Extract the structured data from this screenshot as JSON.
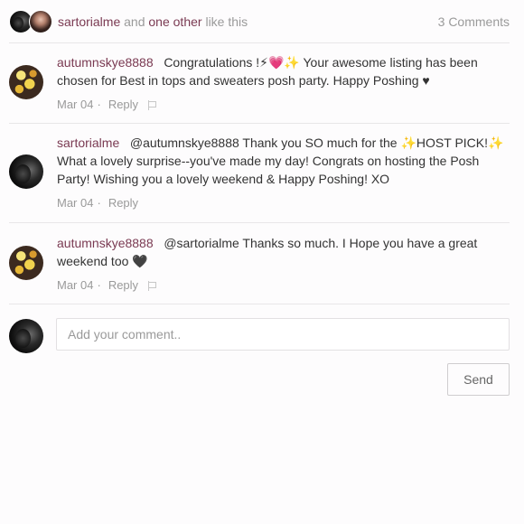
{
  "likes": {
    "user": "sartorialme",
    "connector": "and",
    "others": "one other",
    "suffix": "like this",
    "comments_count": "3 Comments"
  },
  "comments": [
    {
      "author": "autumnskye8888",
      "text": "Congratulations !⚡💗✨ Your awesome listing has been chosen for Best in tops and sweaters posh party. Happy Poshing ♥",
      "date": "Mar 04",
      "reply": "Reply"
    },
    {
      "author": "sartorialme",
      "text": "@autumnskye8888 Thank you SO much for the ✨HOST PICK!✨ What a lovely surprise--you've made my day! Congrats on hosting the Posh Party! Wishing you a lovely weekend & Happy Poshing! XO",
      "date": "Mar 04",
      "reply": "Reply"
    },
    {
      "author": "autumnskye8888",
      "text": "@sartorialme Thanks so much. I Hope you have a great weekend too 🖤",
      "date": "Mar 04",
      "reply": "Reply"
    }
  ],
  "compose": {
    "placeholder": "Add your comment..",
    "send_label": "Send"
  }
}
